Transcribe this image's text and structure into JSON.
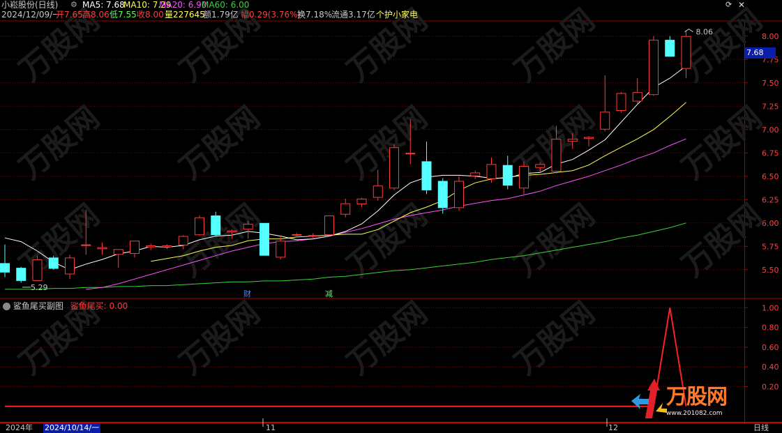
{
  "header": {
    "stock_name": "小崧股份(日线)",
    "ma5": "MA5: 7.68",
    "ma10": "MA10: 7.29",
    "ma20": "MA20: 6.90",
    "ma60": "MA60: 6.00",
    "date": "2024/12/09/一",
    "open": "开7.65",
    "high": "高8.06",
    "low": "低7.55",
    "close": "收8.00",
    "volume": "量227645",
    "amount": "额1.79亿",
    "change": "幅0.29(3.76%)",
    "turnover": "换7.18%",
    "float_cap": "流通3.17亿",
    "tag": "个护小家电"
  },
  "colors": {
    "up": "#ff3c3c",
    "down": "#54ffff",
    "ma5": "#ffffff",
    "ma10": "#ffff54",
    "ma20": "#ff54ff",
    "ma60": "#3cd23c",
    "grid": "#8b0000",
    "axis": "#c8c8c8",
    "subline": "#ff2020"
  },
  "main_chart": {
    "current_price_tag": "7.68",
    "high_marker": "8.06",
    "low_marker": "5.29",
    "event_markers": [
      "财",
      "减"
    ]
  },
  "sub_chart": {
    "title": "鲨鱼尾买副图",
    "value_label": "鲨鱼尾买: 0.00"
  },
  "x_axis": {
    "labels": [
      "2024年",
      "2024/10/14/一",
      "11",
      "12"
    ],
    "period_button": "日线"
  },
  "watermark": {
    "brand": "万股网",
    "url": "www.201082.com"
  },
  "chart_data": [
    {
      "type": "candlestick",
      "title": "小崧股份(日线)",
      "y_ticks": [
        8.0,
        7.75,
        7.5,
        7.25,
        7.0,
        6.75,
        6.5,
        6.25,
        6.0,
        5.75,
        5.5
      ],
      "ylim": [
        5.2,
        8.14
      ],
      "candles": [
        {
          "o": 5.57,
          "h": 5.77,
          "l": 5.42,
          "c": 5.47
        },
        {
          "o": 5.52,
          "h": 5.53,
          "l": 5.36,
          "c": 5.38
        },
        {
          "o": 5.38,
          "h": 5.65,
          "l": 5.38,
          "c": 5.61
        },
        {
          "o": 5.63,
          "h": 5.65,
          "l": 5.5,
          "c": 5.51
        },
        {
          "o": 5.45,
          "h": 5.66,
          "l": 5.4,
          "c": 5.63
        },
        {
          "o": 5.76,
          "h": 6.14,
          "l": 5.66,
          "c": 5.77
        },
        {
          "o": 5.72,
          "h": 5.79,
          "l": 5.66,
          "c": 5.74
        },
        {
          "o": 5.66,
          "h": 5.72,
          "l": 5.52,
          "c": 5.72
        },
        {
          "o": 5.67,
          "h": 5.81,
          "l": 5.63,
          "c": 5.81
        },
        {
          "o": 5.74,
          "h": 5.78,
          "l": 5.71,
          "c": 5.76
        },
        {
          "o": 5.74,
          "h": 5.77,
          "l": 5.72,
          "c": 5.76
        },
        {
          "o": 5.76,
          "h": 5.87,
          "l": 5.72,
          "c": 5.86
        },
        {
          "o": 5.87,
          "h": 6.08,
          "l": 5.86,
          "c": 6.06
        },
        {
          "o": 6.08,
          "h": 6.12,
          "l": 5.86,
          "c": 5.87
        },
        {
          "o": 5.9,
          "h": 5.93,
          "l": 5.83,
          "c": 5.92
        },
        {
          "o": 5.93,
          "h": 6.02,
          "l": 5.83,
          "c": 5.99
        },
        {
          "o": 6.0,
          "h": 6.0,
          "l": 5.65,
          "c": 5.65
        },
        {
          "o": 5.63,
          "h": 5.86,
          "l": 5.61,
          "c": 5.81
        },
        {
          "o": 5.87,
          "h": 5.89,
          "l": 5.85,
          "c": 5.88
        },
        {
          "o": 5.86,
          "h": 5.89,
          "l": 5.84,
          "c": 5.87
        },
        {
          "o": 5.87,
          "h": 6.08,
          "l": 5.86,
          "c": 6.08
        },
        {
          "o": 6.09,
          "h": 6.26,
          "l": 6.06,
          "c": 6.21
        },
        {
          "o": 6.2,
          "h": 6.27,
          "l": 6.17,
          "c": 6.26
        },
        {
          "o": 6.27,
          "h": 6.57,
          "l": 6.24,
          "c": 6.4
        },
        {
          "o": 6.37,
          "h": 6.84,
          "l": 6.35,
          "c": 6.81
        },
        {
          "o": 6.75,
          "h": 7.11,
          "l": 6.63,
          "c": 6.75
        },
        {
          "o": 6.66,
          "h": 6.87,
          "l": 6.31,
          "c": 6.35
        },
        {
          "o": 6.45,
          "h": 6.48,
          "l": 6.1,
          "c": 6.16
        },
        {
          "o": 6.16,
          "h": 6.5,
          "l": 6.13,
          "c": 6.45
        },
        {
          "o": 6.5,
          "h": 6.56,
          "l": 6.47,
          "c": 6.54
        },
        {
          "o": 6.47,
          "h": 6.7,
          "l": 6.43,
          "c": 6.63
        },
        {
          "o": 6.62,
          "h": 6.72,
          "l": 6.36,
          "c": 6.4
        },
        {
          "o": 6.37,
          "h": 6.66,
          "l": 6.31,
          "c": 6.61
        },
        {
          "o": 6.59,
          "h": 6.65,
          "l": 6.55,
          "c": 6.63
        },
        {
          "o": 6.55,
          "h": 7.04,
          "l": 6.53,
          "c": 6.9
        },
        {
          "o": 6.87,
          "h": 6.96,
          "l": 6.79,
          "c": 6.9
        },
        {
          "o": 6.9,
          "h": 6.93,
          "l": 6.82,
          "c": 6.92
        },
        {
          "o": 7.0,
          "h": 7.58,
          "l": 6.98,
          "c": 7.19
        },
        {
          "o": 7.2,
          "h": 7.4,
          "l": 7.18,
          "c": 7.39
        },
        {
          "o": 7.3,
          "h": 7.55,
          "l": 7.28,
          "c": 7.4
        },
        {
          "o": 7.37,
          "h": 8.0,
          "l": 7.36,
          "c": 7.96
        },
        {
          "o": 7.96,
          "h": 8.0,
          "l": 7.78,
          "c": 7.78
        },
        {
          "o": 7.65,
          "h": 8.06,
          "l": 7.55,
          "c": 8.0
        }
      ],
      "ma5": [
        5.84,
        5.8,
        5.7,
        5.58,
        5.5,
        5.56,
        5.61,
        5.67,
        5.7,
        5.75,
        5.74,
        5.76,
        5.82,
        5.86,
        5.87,
        5.91,
        5.89,
        5.86,
        5.82,
        5.83,
        5.86,
        5.91,
        5.99,
        6.13,
        6.3,
        6.43,
        6.49,
        6.51,
        6.51,
        6.5,
        6.48,
        6.48,
        6.53,
        6.54,
        6.63,
        6.68,
        6.78,
        6.89,
        7.08,
        7.27,
        7.45,
        7.55,
        7.68
      ],
      "ma10": [
        null,
        null,
        null,
        null,
        null,
        null,
        null,
        null,
        null,
        5.59,
        5.62,
        5.65,
        5.7,
        5.74,
        5.76,
        5.81,
        5.83,
        5.83,
        5.85,
        5.86,
        5.87,
        5.88,
        5.88,
        5.93,
        6.02,
        6.11,
        6.17,
        6.24,
        6.35,
        6.43,
        6.47,
        6.49,
        6.51,
        6.52,
        6.54,
        6.56,
        6.62,
        6.72,
        6.81,
        6.9,
        7.0,
        7.14,
        7.29
      ],
      "ma20": [
        null,
        null,
        null,
        null,
        null,
        5.29,
        5.31,
        5.35,
        5.4,
        5.45,
        5.5,
        5.55,
        5.6,
        5.65,
        5.7,
        5.74,
        5.78,
        5.8,
        5.81,
        5.83,
        5.86,
        5.9,
        5.94,
        5.99,
        6.04,
        6.08,
        6.11,
        6.14,
        6.18,
        6.21,
        6.24,
        6.26,
        6.3,
        6.34,
        6.4,
        6.45,
        6.5,
        6.56,
        6.62,
        6.69,
        6.75,
        6.83,
        6.9
      ],
      "ma60": [
        5.29,
        5.29,
        5.29,
        5.3,
        5.3,
        5.31,
        5.31,
        5.32,
        5.32,
        5.33,
        5.33,
        5.34,
        5.35,
        5.36,
        5.37,
        5.37,
        5.38,
        5.38,
        5.39,
        5.4,
        5.42,
        5.43,
        5.45,
        5.47,
        5.49,
        5.5,
        5.52,
        5.54,
        5.56,
        5.58,
        5.61,
        5.63,
        5.65,
        5.68,
        5.71,
        5.74,
        5.77,
        5.8,
        5.84,
        5.87,
        5.91,
        5.95,
        6.0
      ]
    },
    {
      "type": "line",
      "title": "鲨鱼尾买副图",
      "y_ticks": [
        1.0,
        0.8,
        0.6,
        0.4,
        0.2
      ],
      "ylim": [
        -0.15,
        1.08
      ],
      "series": [
        {
          "name": "鲨鱼尾买",
          "values": [
            0,
            0,
            0,
            0,
            0,
            0,
            0,
            0,
            0,
            0,
            0,
            0,
            0,
            0,
            0,
            0,
            0,
            0,
            0,
            0,
            0,
            0,
            0,
            0,
            0,
            0,
            0,
            0,
            0,
            0,
            0,
            0,
            0,
            0,
            0,
            0,
            0,
            0,
            0,
            0,
            0,
            1,
            0
          ]
        }
      ]
    }
  ]
}
